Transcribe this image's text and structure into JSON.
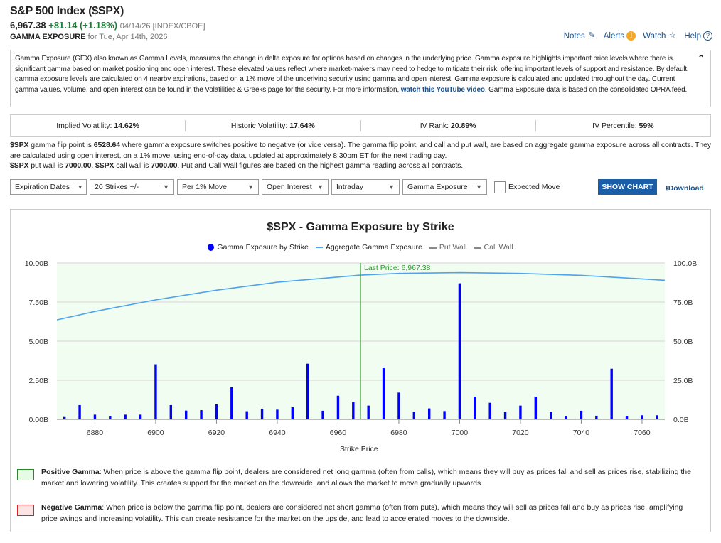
{
  "header": {
    "title": "S&P 500 Index ($SPX)",
    "price": "6,967.38",
    "change": "+81.14 (+1.18%)",
    "meta": "04/14/26 [INDEX/CBOE]",
    "section": "GAMMA EXPOSURE",
    "date": "for Tue, Apr 14th, 2026"
  },
  "tools": {
    "notes": "Notes",
    "alerts": "Alerts",
    "watch": "Watch",
    "help": "Help"
  },
  "description": {
    "text": "Gamma Exposure (GEX) also known as Gamma Levels, measures the change in delta exposure for options based on changes in the underlying price. Gamma exposure highlights important price levels where there is significant gamma based on market positioning and open interest. These elevated values reflect where market-makers may need to hedge to mitigate their risk, offering important levels of support and resistance. By default, gamma exposure levels are calculated on 4 nearby expirations, based on a 1% move of the underlying security using gamma and open interest. Gamma exposure is calculated and updated throughout the day. Current gamma values, volume, and open interest can be found in the Volatilities & Greeks page for the security. For more information, ",
    "link": "watch this YouTube video",
    "tail": ". Gamma Exposure data is based on the consolidated OPRA feed."
  },
  "stats": [
    {
      "label": "Implied Volatility: ",
      "value": "14.62%"
    },
    {
      "label": "Historic Volatility: ",
      "value": "17.64%"
    },
    {
      "label": "IV Rank: ",
      "value": "20.89%"
    },
    {
      "label": "IV Percentile: ",
      "value": "59%"
    }
  ],
  "flip": {
    "sym": "$SPX",
    "t1": " gamma flip point is ",
    "flip": "6528.64",
    "t2": " where gamma exposure switches positive to negative (or vice versa). The gamma flip point, and call and put wall, are based on aggregate gamma exposure across all contracts. They are calculated using open interest, on a 1% move, using end-of-day data, updated at approximately 8:30pm ET for the next trading day.",
    "t3": " put wall is ",
    "put": "7000.00",
    "t4": ". ",
    "t5": " call wall is ",
    "call": "7000.00",
    "t6": ". Put and Call Wall figures are based on the highest gamma reading across all contracts."
  },
  "controls": {
    "expiration": "Expiration Dates",
    "strikes": "20 Strikes +/-",
    "move": "Per 1% Move",
    "basis": "Open Interest",
    "period": "Intraday",
    "metric": "Gamma Exposure",
    "expected_move": "Expected Move",
    "show_chart": "SHOW CHART",
    "download": "Download"
  },
  "chart_data": {
    "type": "bar",
    "title": "$SPX - Gamma Exposure by Strike",
    "xlabel": "Strike Price",
    "legend": [
      "Gamma Exposure by Strike",
      "Aggregate Gamma Exposure",
      "Put Wall",
      "Call Wall"
    ],
    "xlim": [
      6867.5,
      7067.5
    ],
    "xticks": [
      6880,
      6900,
      6920,
      6940,
      6960,
      6980,
      7000,
      7020,
      7040,
      7060
    ],
    "ylim_left": [
      0,
      10
    ],
    "yticks_left": [
      "0.00B",
      "2.50B",
      "5.00B",
      "7.50B",
      "10.00B"
    ],
    "ylim_right": [
      0,
      100
    ],
    "yticks_right": [
      "0.0B",
      "25.0B",
      "50.0B",
      "75.0B",
      "100.0B"
    ],
    "last_price_label": "Last Price: 6,967.38",
    "last_price": 6967.38,
    "colors": {
      "bars": "#0000ff",
      "aggregate": "#4da3f0",
      "last_price": "#2a9a2a",
      "bg": "#f1fdf0"
    },
    "strikes": [
      6870,
      6875,
      6880,
      6885,
      6890,
      6895,
      6900,
      6905,
      6910,
      6915,
      6920,
      6925,
      6930,
      6935,
      6940,
      6945,
      6950,
      6955,
      6960,
      6965,
      6970,
      6975,
      6980,
      6985,
      6990,
      6995,
      7000,
      7005,
      7010,
      7015,
      7020,
      7025,
      7030,
      7035,
      7040,
      7045,
      7050,
      7055,
      7060,
      7065
    ],
    "gamma_b": [
      0.15,
      0.91,
      0.3,
      0.18,
      0.3,
      0.3,
      3.52,
      0.91,
      0.56,
      0.59,
      0.96,
      2.05,
      0.52,
      0.67,
      0.62,
      0.78,
      3.56,
      0.55,
      1.51,
      1.11,
      0.88,
      3.27,
      1.71,
      0.48,
      0.7,
      0.53,
      8.7,
      1.45,
      1.06,
      0.48,
      0.88,
      1.45,
      0.48,
      0.18,
      0.55,
      0.23,
      3.24,
      0.18,
      0.26,
      0.26
    ],
    "aggregate": {
      "x": [
        6867.5,
        6880,
        6900,
        6920,
        6940,
        6960,
        6967,
        6980,
        7000,
        7020,
        7040,
        7060,
        7067.5
      ],
      "y": [
        63.6,
        69,
        76.4,
        82.6,
        87.7,
        91,
        92.2,
        93.3,
        93.8,
        93.3,
        92.1,
        89.8,
        88.9
      ]
    }
  },
  "notes": [
    {
      "title": "Positive Gamma",
      "text": ": When price is above the gamma flip point, dealers are considered net long gamma (often from calls), which means they will buy as prices fall and sell as prices rise, stabilizing the market and lowering volatility. This creates support for the market on the downside, and allows the market to move gradually upwards."
    },
    {
      "title": "Negative Gamma",
      "text": ": When price is below the gamma flip point, dealers are considered net short gamma (often from puts), which means they will sell as prices fall and buy as prices rise, amplifying price swings and increasing volatility. This can create resistance for the market on the upside, and lead to accelerated moves to the downside."
    }
  ]
}
